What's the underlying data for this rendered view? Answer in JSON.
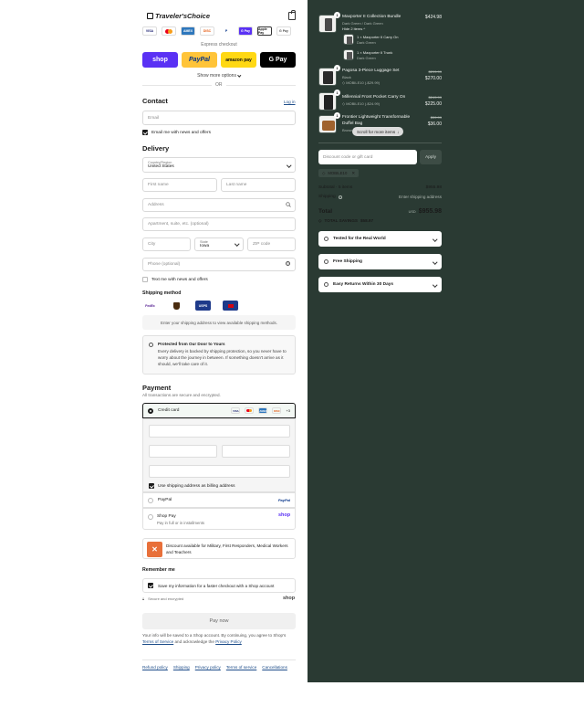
{
  "brand": {
    "name": "Traveler'sChoice"
  },
  "express": {
    "cards": [
      "VISA",
      "MC",
      "AMEX",
      "DISC",
      "PP",
      "G Pay",
      "Apple Pay",
      "G Pay"
    ],
    "title": "Express checkout",
    "buttons": {
      "shop": "shop",
      "paypal": "PayPal",
      "amazon": "amazon pay",
      "gpay": "G Pay"
    },
    "more_options": "Show more options",
    "or": "OR"
  },
  "contact": {
    "title": "Contact",
    "login": "Log in",
    "email_placeholder": "Email",
    "newsletter": "Email me with news and offers"
  },
  "delivery": {
    "title": "Delivery",
    "country_label": "Country/Region",
    "country_value": "United States",
    "first_name": "First name",
    "last_name": "Last name",
    "address": "Address",
    "apartment": "Apartment, suite, etc. (optional)",
    "city": "City",
    "state_label": "State",
    "state_value": "Iowa",
    "zip": "ZIP code",
    "phone": "Phone (optional)",
    "text_offers": "Text me with news and offers"
  },
  "shipping": {
    "title": "Shipping method",
    "carriers": [
      "FedEx",
      "UPS",
      "USPS",
      "DHL"
    ],
    "notice": "Enter your shipping address to view available shipping methods.",
    "protect_title": "Protected from Our Door to Yours",
    "protect_body": "Every delivery is backed by shipping protection, so you never have to worry about the journey in between. If something doesn't arrive as it should, we'll take care of it."
  },
  "payment": {
    "title": "Payment",
    "subtitle": "All transactions are secure and encrypted.",
    "credit_card": "Credit card",
    "card_logos": [
      "VISA",
      "MC",
      "AMEX",
      "DISC"
    ],
    "more_cards": "+3",
    "billing_same": "Use shipping address as billing address",
    "paypal": "PayPal",
    "shop_pay": "Shop Pay",
    "shop_pay_sub": "Pay in full or in installments",
    "shop_logo": "shop"
  },
  "discount_banner": "Discount available for Military, First Responders, Medical Workers and Teachers",
  "remember": {
    "title": "Remember me",
    "save_info": "Save my information for a faster checkout with a Shop account",
    "secure": "Secure and encrypted",
    "shop_logo": "shop"
  },
  "pay_now": "Pay now",
  "legal": {
    "prefix": "Your info will be saved to a Shop account. By continuing, you agree to Shop's",
    "terms": "Terms of Service",
    "and": "and acknowledge the",
    "privacy": "Privacy Policy"
  },
  "footer_links": [
    "Refund policy",
    "Shipping",
    "Privacy policy",
    "Terms of service",
    "Cancellations"
  ],
  "summary": {
    "items": [
      {
        "qty": "1",
        "name": "Maxporter II Collection Bundle",
        "variant": "Dark Green / Dark Green",
        "toggle": "Hide 2 items",
        "price": "$424.98",
        "subitems": [
          {
            "name": "1 × Maxporter II Carry On",
            "variant": "Dark Green"
          },
          {
            "name": "1 × Maxporter II Trunk",
            "variant": "Dark Green"
          }
        ]
      },
      {
        "qty": "1",
        "name": "Pagosa 3-Piece Luggage Set",
        "variant": "Black",
        "discount": "MOBILE10 (-$29.99)",
        "old_price": "$299.99",
        "price": "$270.00"
      },
      {
        "qty": "1",
        "name": "Millennial Front Pocket Carry On",
        "variant": "",
        "discount": "MOBILE10 (-$24.99)",
        "old_price": "$249.99",
        "price": "$225.00"
      },
      {
        "qty": "1",
        "name": "Frontier Lightweight Transformable Duffel Bag",
        "variant": "Brown",
        "old_price": "$39.99",
        "price": "$36.00"
      }
    ],
    "scroll_hint": "Scroll for more items",
    "discount_placeholder": "Discount code or gift card",
    "apply": "Apply",
    "applied_code": "MOBILE10",
    "subtotal_label": "Subtotal · 5 items",
    "subtotal": "$955.98",
    "shipping_label": "Shipping",
    "shipping_value": "Enter shipping address",
    "total_label": "Total",
    "currency": "USD",
    "total": "$955.98",
    "savings_label": "TOTAL SAVINGS",
    "savings": "$58.97",
    "accordions": [
      "Tested for the Real World",
      "Free Shipping",
      "Easy Returns Within 30 Days"
    ]
  },
  "colors": {
    "sidebar_bg": "#2a3a33",
    "shop_purple": "#5a31f4",
    "paypal_yellow": "#ffc439",
    "link": "#1f4e8a"
  }
}
